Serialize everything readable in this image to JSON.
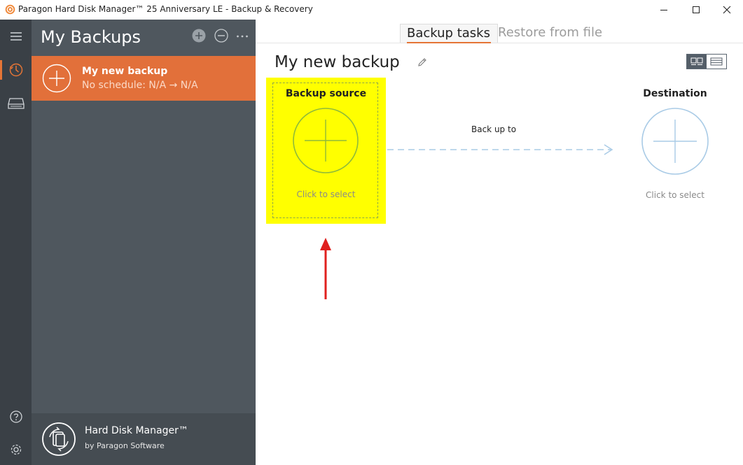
{
  "window": {
    "title": "Paragon Hard Disk Manager™ 25 Anniversary LE - Backup & Recovery",
    "icon": "paragon-app-icon",
    "controls": [
      "minimize-icon",
      "maximize-icon",
      "close-icon"
    ]
  },
  "rail": {
    "items": [
      {
        "name": "menu",
        "icon": "hamburger-icon"
      },
      {
        "name": "backup-recovery",
        "icon": "clock-icon",
        "active": true
      },
      {
        "name": "disks",
        "icon": "disk-drive-icon"
      },
      {
        "name": "help",
        "icon": "help-icon"
      },
      {
        "name": "settings",
        "icon": "gear-icon"
      }
    ]
  },
  "panel": {
    "title": "My Backups",
    "controls": [
      "add-icon",
      "remove-icon",
      "more-icon"
    ],
    "items": [
      {
        "name": "My new backup",
        "schedule": "No schedule: N/A → N/A",
        "selected": true
      }
    ],
    "footer": {
      "product": "Hard Disk Manager™",
      "vendor": "by Paragon Software"
    }
  },
  "tabs": [
    {
      "label": "Backup tasks",
      "active": true
    },
    {
      "label": "Restore from file",
      "active": false
    }
  ],
  "task": {
    "title": "My new backup",
    "source": {
      "title": "Backup source",
      "hint": "Click to select"
    },
    "link_label": "Back up to",
    "destination": {
      "title": "Destination",
      "hint": "Click to select"
    }
  },
  "colors": {
    "accent": "#e2703a",
    "rail": "#3a4046",
    "panel": "#4f575e",
    "highlight": "#ffff00",
    "plus_source": "#8fba3a",
    "plus_destination": "#a9cbe6",
    "annotation_arrow": "#e0201e"
  }
}
